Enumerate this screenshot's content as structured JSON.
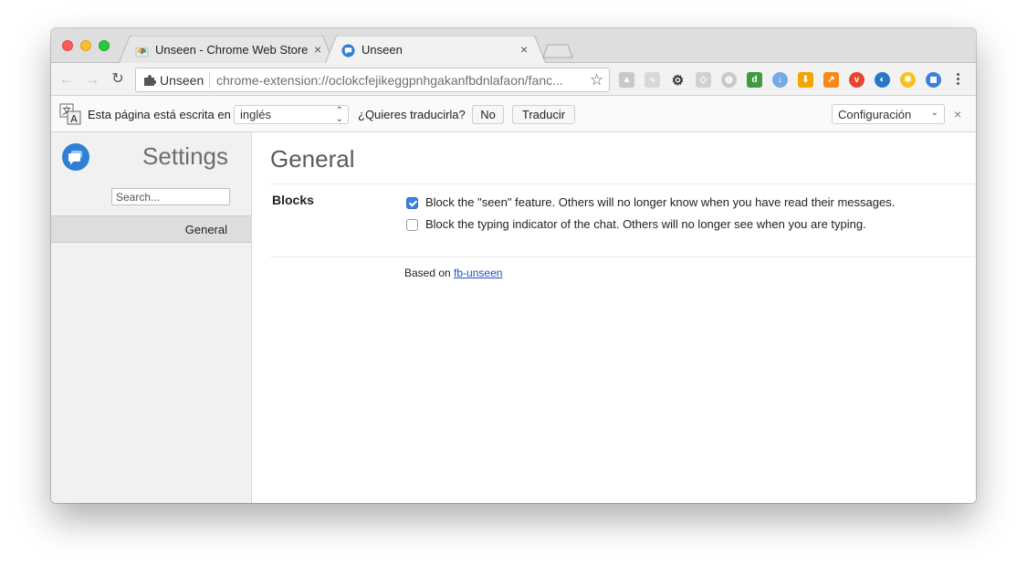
{
  "tabs": [
    {
      "title": "Unseen - Chrome Web Store",
      "close": "×",
      "icon": "chrome-web-store-icon",
      "active": false
    },
    {
      "title": "Unseen",
      "close": "×",
      "icon": "unseen-chat-icon",
      "active": true
    }
  ],
  "omnibox": {
    "chip": "Unseen",
    "url": "chrome-extension://oclokcfejikeggpnhgakanfbdnlafaon/fanc..."
  },
  "extensions": [
    {
      "icon": "drive-icon",
      "color": "#c8c8c8",
      "glyph": "▲"
    },
    {
      "icon": "share-icon",
      "color": "#d8d8d8",
      "glyph": "⤷"
    },
    {
      "icon": "gear-icon",
      "color": "#333333",
      "glyph": "⚙"
    },
    {
      "icon": "tag-icon",
      "color": "#d0d0d0",
      "glyph": "◇"
    },
    {
      "icon": "globe-icon",
      "color": "#c9c9c9",
      "glyph": "◍"
    },
    {
      "icon": "d-icon",
      "color": "#3f9b3f",
      "glyph": "d"
    },
    {
      "icon": "download-circle-icon",
      "color": "#78a9e6",
      "glyph": "↓"
    },
    {
      "icon": "download-arrow-icon",
      "color": "#f0a500",
      "glyph": "⬇"
    },
    {
      "icon": "chart-icon",
      "color": "#f28a1d",
      "glyph": "↗"
    },
    {
      "icon": "vivaldi-icon",
      "color": "#e8432e",
      "glyph": "v"
    },
    {
      "icon": "moon-icon",
      "color": "#2b76c8",
      "glyph": "◐"
    },
    {
      "icon": "walker-icon",
      "color": "#f3c21f",
      "glyph": "✱"
    },
    {
      "icon": "unseen-extension-icon",
      "color": "#3b82d6",
      "glyph": "◼"
    }
  ],
  "translate": {
    "intro": "Esta página está escrita en",
    "language": "inglés",
    "question": "¿Quieres traducirla?",
    "no_label": "No",
    "translate_label": "Traducir",
    "config_label": "Configuración",
    "close": "×"
  },
  "sidebar": {
    "title": "Settings",
    "search_placeholder": "Search...",
    "items": [
      {
        "label": "General"
      }
    ]
  },
  "main": {
    "title": "General",
    "section": "Blocks",
    "options": [
      {
        "label": "Block the \"seen\" feature. Others will no longer know when you have read their messages.",
        "checked": true
      },
      {
        "label": "Block the typing indicator of the chat. Others will no longer see when you are typing.",
        "checked": false
      }
    ],
    "footer_prefix": "Based on ",
    "footer_link": "fb-unseen"
  }
}
